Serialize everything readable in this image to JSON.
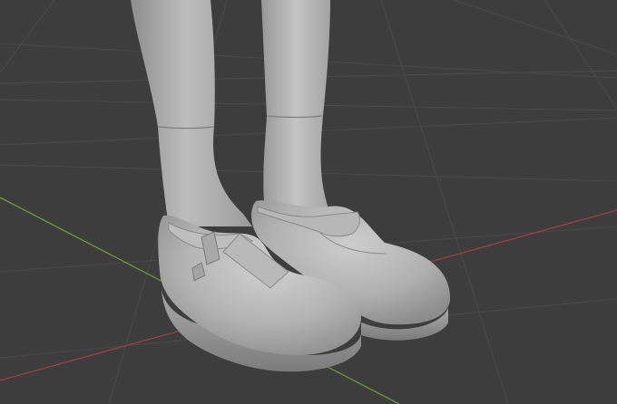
{
  "viewport": {
    "background": "#3d3d3d",
    "grid_color": "#4a4a4a",
    "x_axis_color": "#9a3f4b",
    "y_axis_color": "#6f9a3a",
    "mesh_color": "#b8b8b8"
  }
}
